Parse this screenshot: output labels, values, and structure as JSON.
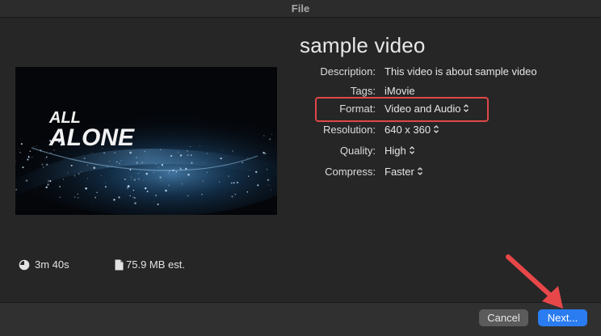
{
  "window": {
    "title": "File"
  },
  "video": {
    "title": "sample video",
    "thumbnail_text_line1": "ALL",
    "thumbnail_text_line2": "ALONE"
  },
  "fields": {
    "description": {
      "label": "Description:",
      "value": "This video is about sample video"
    },
    "tags": {
      "label": "Tags:",
      "value": "iMovie"
    },
    "format": {
      "label": "Format:",
      "value": "Video and Audio"
    },
    "resolution": {
      "label": "Resolution:",
      "value": "640 x 360"
    },
    "quality": {
      "label": "Quality:",
      "value": "High"
    },
    "compress": {
      "label": "Compress:",
      "value": "Faster"
    }
  },
  "stats": {
    "duration": "3m 40s",
    "size": "75.9 MB est."
  },
  "buttons": {
    "cancel": "Cancel",
    "next": "Next..."
  },
  "annotation": {
    "highlight_color": "#e0474a",
    "arrow_color": "#e8474a",
    "highlight_target": "format"
  },
  "colors": {
    "background": "#262626",
    "primary_button": "#2a7cf0"
  }
}
